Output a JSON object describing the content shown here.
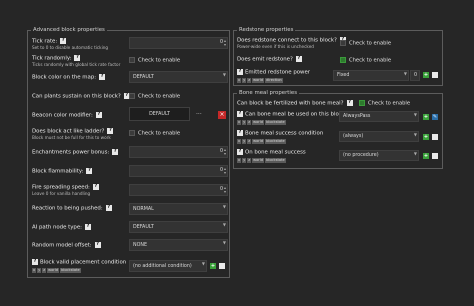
{
  "left_panel": {
    "title": "Advanced block properties",
    "tick_rate": {
      "label": "Tick rate:",
      "sub": "Set to 0 to disable automatic ticking",
      "value": "0"
    },
    "tick_random": {
      "label": "Tick randomly:",
      "sub": "Ticks randomly with global tick rate factor",
      "check": "Check to enable"
    },
    "map_color": {
      "label": "Block color on the map:",
      "value": "DEFAULT"
    },
    "plants_sustain": {
      "label": "Can plants sustain on this block?",
      "check": "Check to enable"
    },
    "beacon": {
      "label": "Beacon color modifier:",
      "value": "DEFAULT",
      "dots": "..."
    },
    "ladder": {
      "label": "Does block act like ladder?",
      "sub": "Block must not be full for this to work",
      "check": "Check to enable"
    },
    "enchant": {
      "label": "Enchantments power bonus:",
      "value": "0"
    },
    "flammability": {
      "label": "Block flammability:",
      "value": "0"
    },
    "fire_speed": {
      "label": "Fire spreading speed:",
      "sub": "Leave 0 for vanilla handling",
      "value": "0"
    },
    "pushed": {
      "label": "Reaction to being pushed:",
      "value": "NORMAL"
    },
    "ai_path": {
      "label": "AI path node type:",
      "value": "DEFAULT"
    },
    "random_offset": {
      "label": "Random model offset:",
      "value": "NONE"
    },
    "placement": {
      "label": "Block valid placement condition",
      "value": "(no additional condition)",
      "tags": [
        "x",
        "y",
        "z",
        "world",
        "blockstate"
      ]
    }
  },
  "right_top": {
    "title": "Redstone properties",
    "connect": {
      "label": "Does redstone connect to this block?",
      "sub": "Power-wide even if this is unchecked",
      "check": "Check to enable"
    },
    "emit": {
      "label": "Does emit redstone?",
      "check": "Check to enable"
    },
    "emitted": {
      "label": "Emitted redstone power",
      "tags": [
        "x",
        "y",
        "z",
        "world",
        "direction"
      ],
      "mode": "Fixed",
      "value": "0"
    }
  },
  "right_bottom": {
    "title": "Bone meal properties",
    "fertilized": {
      "label": "Can block be fertilized with bone meal?",
      "check": "Check to enable"
    },
    "used": {
      "label": "Can bone meal be used on this block",
      "tags": [
        "x",
        "y",
        "z",
        "world",
        "blockstate"
      ],
      "value": "AlwaysPass"
    },
    "success": {
      "label": "Bone meal success condition",
      "tags": [
        "x",
        "y",
        "z",
        "world",
        "blockstate"
      ],
      "value": "(always)"
    },
    "on_success": {
      "label": "On bone meal success",
      "tags": [
        "x",
        "y",
        "z",
        "world",
        "blockstate"
      ],
      "value": "(no procedure)"
    }
  },
  "icons": {
    "help": "?",
    "plus": "+",
    "pencil": "✎",
    "close": "×",
    "arrow": "▼"
  }
}
